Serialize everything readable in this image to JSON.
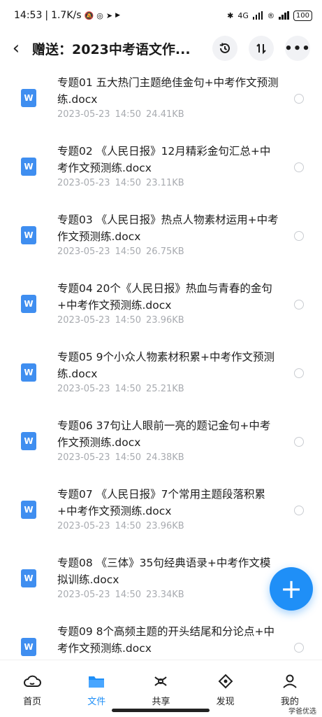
{
  "status_bar": {
    "time": "14:53",
    "speed": "1.7K/s",
    "battery": "100",
    "network": "4G"
  },
  "header": {
    "title": "赠送：2023中考语文作..."
  },
  "files": [
    {
      "name": "专题01  五大热门主题绝佳金句+中考作文预测练.docx",
      "date": "2023-05-23",
      "time": "14:50",
      "size": "24.41KB"
    },
    {
      "name": "专题02  《人民日报》12月精彩金句汇总+中考作文预测练.docx",
      "date": "2023-05-23",
      "time": "14:50",
      "size": "23.11KB"
    },
    {
      "name": "专题03  《人民日报》热点人物素材运用+中考作文预测练.docx",
      "date": "2023-05-23",
      "time": "14:50",
      "size": "26.75KB"
    },
    {
      "name": "专题04  20个《人民日报》热血与青春的金句+中考作文预测练.docx",
      "date": "2023-05-23",
      "time": "14:50",
      "size": "23.96KB"
    },
    {
      "name": "专题05  9个小众人物素材积累+中考作文预测练.docx",
      "date": "2023-05-23",
      "time": "14:50",
      "size": "25.21KB"
    },
    {
      "name": "专题06  37句让人眼前一亮的题记金句+中考作文预测练.docx",
      "date": "2023-05-23",
      "time": "14:50",
      "size": "24.38KB"
    },
    {
      "name": "专题07  《人民日报》7个常用主题段落积累+中考作文预测练.docx",
      "date": "2023-05-23",
      "time": "14:50",
      "size": "23.96KB"
    },
    {
      "name": "专题08  《三体》35句经典语录+中考作文模拟训练.docx",
      "date": "2023-05-23",
      "time": "14:50",
      "size": "23.34KB"
    },
    {
      "name": "专题09  8个高频主题的开头结尾和分论点+中考作文预测练.docx",
      "date": "",
      "time": "",
      "size": ""
    }
  ],
  "tabs": [
    {
      "label": "首页",
      "icon": "cloud-icon"
    },
    {
      "label": "文件",
      "icon": "folder-icon",
      "active": true
    },
    {
      "label": "共享",
      "icon": "share-icon"
    },
    {
      "label": "发现",
      "icon": "discover-icon"
    },
    {
      "label": "我的",
      "icon": "profile-icon"
    }
  ],
  "watermark": {
    "text_a": "学爸",
    "text_b": "优",
    "text_c": "选",
    "small": "学爸优选"
  },
  "colors": {
    "accent": "#1f8ff7",
    "file_icon": "#3f8ef0",
    "meta_text": "#a8abb0"
  }
}
